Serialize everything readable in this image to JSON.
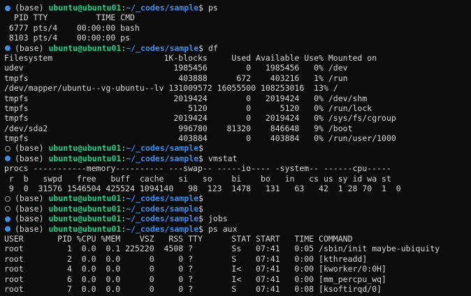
{
  "colors": {
    "background": "#0c0c0c",
    "text": "#d6d6d6",
    "user_host": "#23d18b",
    "path": "#3b8eea",
    "marker_filled": "#3b8eea",
    "marker_hollow": "#9a9a9a"
  },
  "prompt": {
    "env": "(base) ",
    "user_host": "ubuntu@ubuntu01",
    "colon": ":",
    "path": "~/_codes/sample",
    "symbol": "$ "
  },
  "lines": [
    {
      "type": "prompt",
      "marker": "filled",
      "cmd": "ps"
    },
    {
      "type": "output",
      "text": "  PID TTY          TIME CMD"
    },
    {
      "type": "output",
      "text": " 6777 pts/4    00:00:00 bash"
    },
    {
      "type": "output",
      "text": " 8103 pts/4    00:00:00 ps"
    },
    {
      "type": "prompt",
      "marker": "filled",
      "cmd": "df"
    },
    {
      "type": "output",
      "text": "Filesystem                       1K-blocks     Used Available Use% Mounted on"
    },
    {
      "type": "output",
      "text": "udev                               1985456        0   1985456   0% /dev"
    },
    {
      "type": "output",
      "text": "tmpfs                               403888      672    403216   1% /run"
    },
    {
      "type": "output",
      "text": "/dev/mapper/ubuntu--vg-ubuntu--lv 131009572 16055500 108253016  13% /"
    },
    {
      "type": "output",
      "text": "tmpfs                              2019424        0   2019424   0% /dev/shm"
    },
    {
      "type": "output",
      "text": "tmpfs                                 5120        0      5120   0% /run/lock"
    },
    {
      "type": "output",
      "text": "tmpfs                              2019424        0   2019424   0% /sys/fs/cgroup"
    },
    {
      "type": "output",
      "text": "/dev/sda2                           996780    81320    846648   9% /boot"
    },
    {
      "type": "output",
      "text": "tmpfs                               403884        0    403884   0% /run/user/1000"
    },
    {
      "type": "prompt",
      "marker": "hollow",
      "cmd": ""
    },
    {
      "type": "prompt",
      "marker": "filled",
      "cmd": "vmstat"
    },
    {
      "type": "output",
      "text": "procs -----------memory---------- ---swap-- -----io---- -system-- ------cpu-----"
    },
    {
      "type": "output",
      "text": " r  b   swpd   free   buff  cache   si   so    bi    bo   in   cs us sy id wa st"
    },
    {
      "type": "output",
      "text": " 9  0  31576 1546504 425524 1094140   98  123  1478   131   63   42  1 28 70  1  0"
    },
    {
      "type": "prompt",
      "marker": "hollow",
      "cmd": ""
    },
    {
      "type": "prompt",
      "marker": "hollow",
      "cmd": ""
    },
    {
      "type": "prompt",
      "marker": "filled",
      "cmd": "jobs"
    },
    {
      "type": "prompt",
      "marker": "filled",
      "cmd": "ps aux"
    },
    {
      "type": "output",
      "text": "USER       PID %CPU %MEM    VSZ   RSS TTY      STAT START   TIME COMMAND"
    },
    {
      "type": "output",
      "text": "root         1  0.0  0.1 225220  4508 ?        Ss   07:41   0:05 /sbin/init maybe-ubiquity"
    },
    {
      "type": "output",
      "text": "root         2  0.0  0.0      0     0 ?        S    07:41   0:00 [kthreadd]"
    },
    {
      "type": "output",
      "text": "root         4  0.0  0.0      0     0 ?        I<   07:41   0:00 [kworker/0:0H]"
    },
    {
      "type": "output",
      "text": "root         6  0.0  0.0      0     0 ?        I<   07:41   0:00 [mm_percpu_wq]"
    },
    {
      "type": "output",
      "text": "root         7  0.0  0.0      0     0 ?        S    07:41   0:08 [ksoftirqd/0]"
    }
  ]
}
